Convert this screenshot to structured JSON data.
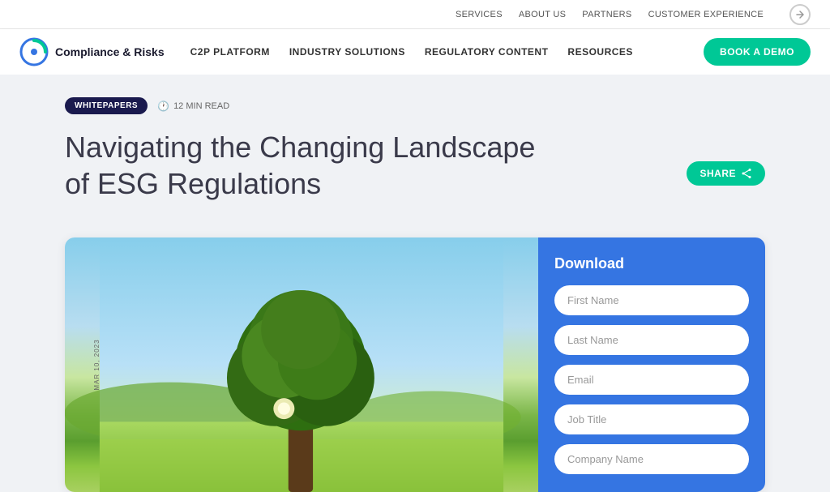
{
  "top_nav": {
    "links": [
      "SERVICES",
      "ABOUT US",
      "PARTNERS",
      "CUSTOMER EXPERIENCE"
    ]
  },
  "main_nav": {
    "logo_text": "Compliance & Risks",
    "links": [
      "C2P PLATFORM",
      "INDUSTRY SOLUTIONS",
      "REGULATORY CONTENT",
      "RESOURCES"
    ],
    "book_demo": "BOOK A DEMO"
  },
  "badges": {
    "category": "WHITEPAPERS",
    "read_time": "12 MIN READ"
  },
  "article": {
    "title": "Navigating the Changing Landscape of ESG Regulations",
    "share_label": "SHARE",
    "date": "MAR 10, 2023"
  },
  "form": {
    "title": "Download",
    "fields": [
      {
        "placeholder": "First Name",
        "name": "first-name"
      },
      {
        "placeholder": "Last Name",
        "name": "last-name"
      },
      {
        "placeholder": "Email",
        "name": "email"
      },
      {
        "placeholder": "Job Title",
        "name": "job-title"
      },
      {
        "placeholder": "Company Name",
        "name": "company-name"
      }
    ]
  }
}
